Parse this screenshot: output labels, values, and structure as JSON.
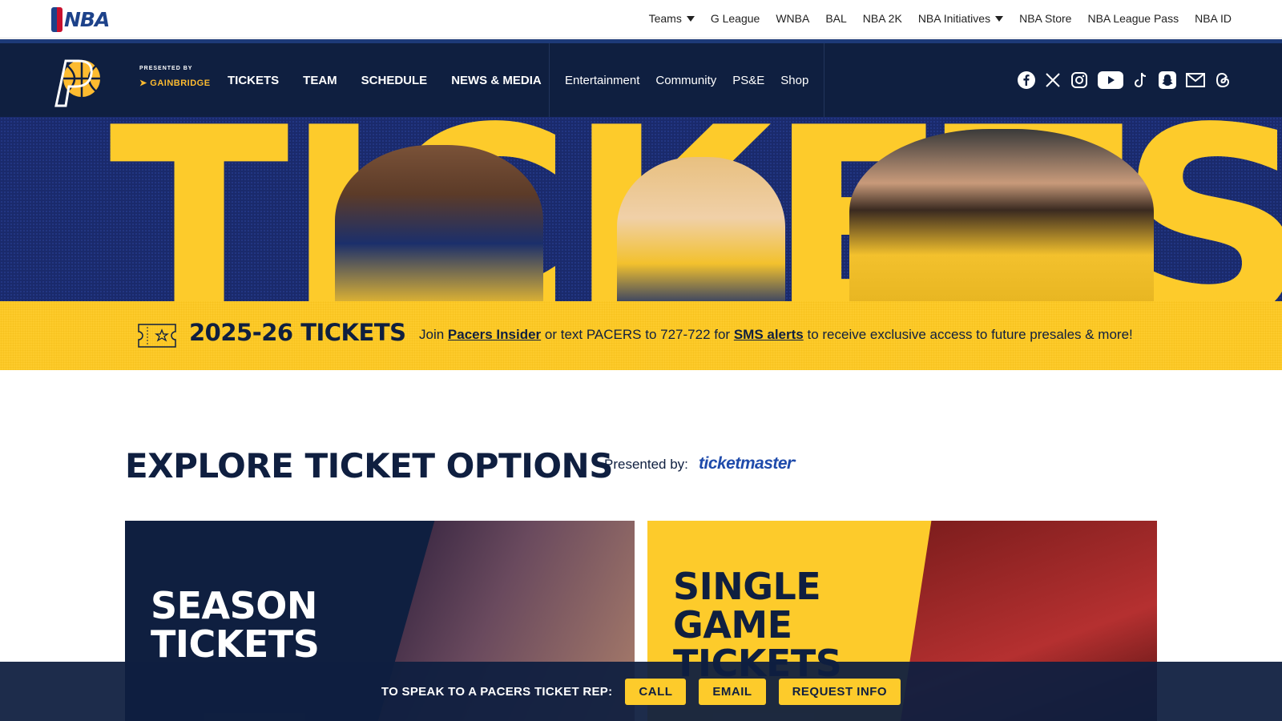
{
  "nba_bar": {
    "logo_text": "NBA",
    "nav": [
      {
        "label": "Teams",
        "dropdown": true
      },
      {
        "label": "G League",
        "dropdown": false
      },
      {
        "label": "WNBA",
        "dropdown": false
      },
      {
        "label": "BAL",
        "dropdown": false
      },
      {
        "label": "NBA 2K",
        "dropdown": false
      },
      {
        "label": "NBA Initiatives",
        "dropdown": true
      },
      {
        "label": "NBA Store",
        "dropdown": false
      },
      {
        "label": "NBA League Pass",
        "dropdown": false
      },
      {
        "label": "NBA ID",
        "dropdown": false
      }
    ]
  },
  "team_bar": {
    "presented_by": "PRESENTED BY",
    "sponsor": "GAINBRIDGE",
    "main_nav": [
      "TICKETS",
      "TEAM",
      "SCHEDULE",
      "NEWS & MEDIA"
    ],
    "sub_nav": [
      "Entertainment",
      "Community",
      "PS&E",
      "Shop"
    ],
    "social_icons": [
      "facebook-icon",
      "x-icon",
      "instagram-icon",
      "youtube-icon",
      "tiktok-icon",
      "snapchat-icon",
      "email-icon",
      "threads-icon"
    ]
  },
  "hero": {
    "headline": "TICKETS"
  },
  "band": {
    "title": "2025-26 TICKETS",
    "text_1": "Join ",
    "link_1": "Pacers Insider",
    "text_2": " or text PACERS to 727-722 for ",
    "link_2": "SMS alerts",
    "text_3": " to receive exclusive access to future presales & more!"
  },
  "explore": {
    "title": "EXPLORE TICKET OPTIONS",
    "presented_by": "Presented by:",
    "sponsor": "ticketmaster",
    "cards": [
      {
        "title_line_1": "SEASON",
        "title_line_2": "TICKETS"
      },
      {
        "title_line_1": "SINGLE",
        "title_line_2": "GAME",
        "title_line_3": "TICKETS"
      }
    ]
  },
  "rep_bar": {
    "text": "TO SPEAK TO A PACERS TICKET REP:",
    "buttons": [
      "CALL",
      "EMAIL",
      "REQUEST INFO"
    ]
  },
  "colors": {
    "navy": "#0f1f40",
    "gold": "#fdcb2b",
    "nba_blue": "#1d428a",
    "nba_red": "#c8102e"
  }
}
